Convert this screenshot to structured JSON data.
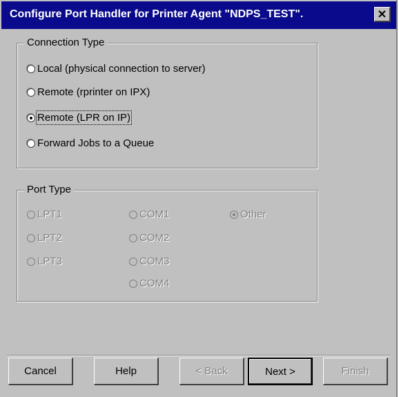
{
  "window": {
    "title": "Configure Port Handler for Printer Agent \"NDPS_TEST\".",
    "close_glyph": "✕"
  },
  "connection_type": {
    "legend": "Connection Type",
    "options": [
      {
        "label": "Local (physical connection to server)",
        "checked": false
      },
      {
        "label": "Remote (rprinter on IPX)",
        "checked": false
      },
      {
        "label": "Remote (LPR on IP)",
        "checked": true
      },
      {
        "label": "Forward Jobs to a Queue",
        "checked": false
      }
    ]
  },
  "port_type": {
    "legend": "Port Type",
    "enabled": false,
    "options": [
      {
        "label": "LPT1",
        "checked": false
      },
      {
        "label": "LPT2",
        "checked": false
      },
      {
        "label": "LPT3",
        "checked": false
      },
      {
        "label": "COM1",
        "checked": false
      },
      {
        "label": "COM2",
        "checked": false
      },
      {
        "label": "COM3",
        "checked": false
      },
      {
        "label": "COM4",
        "checked": false
      },
      {
        "label": "Other",
        "checked": true
      }
    ]
  },
  "buttons": {
    "cancel": "Cancel",
    "help": "Help",
    "back": "< Back",
    "next": "Next >",
    "finish": "Finish"
  }
}
